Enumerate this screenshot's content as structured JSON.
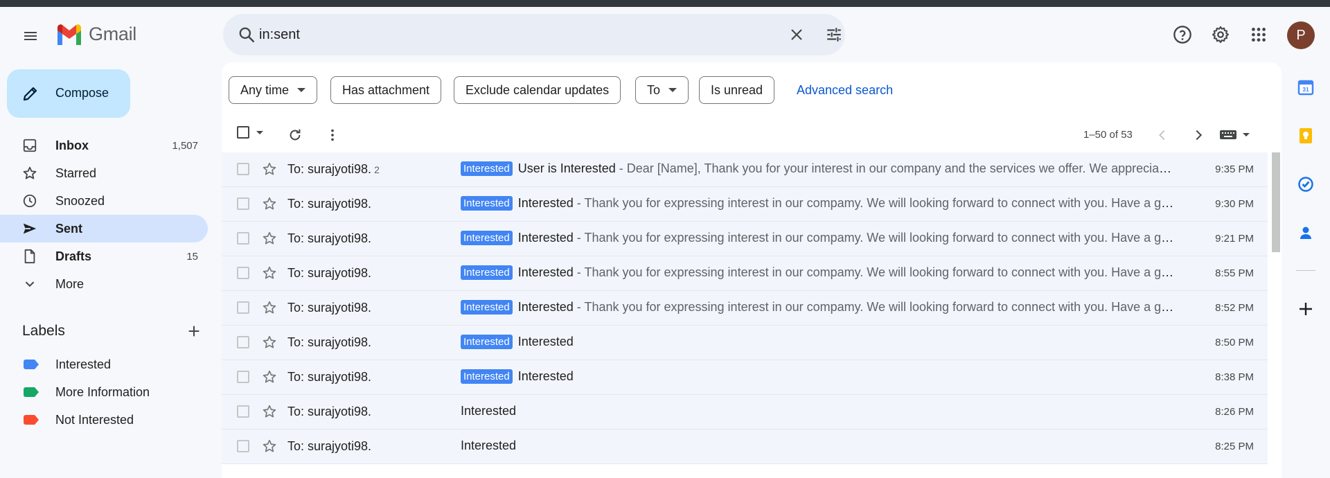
{
  "app": {
    "name": "Gmail"
  },
  "search": {
    "query": "in:sent"
  },
  "user": {
    "initial": "P"
  },
  "compose": {
    "label": "Compose"
  },
  "nav": [
    {
      "name": "inbox",
      "label": "Inbox",
      "count": "1,507",
      "icon": "inbox-icon",
      "bold": true
    },
    {
      "name": "starred",
      "label": "Starred",
      "count": "",
      "icon": "star-icon",
      "bold": false
    },
    {
      "name": "snoozed",
      "label": "Snoozed",
      "count": "",
      "icon": "clock-icon",
      "bold": false
    },
    {
      "name": "sent",
      "label": "Sent",
      "count": "",
      "icon": "send-icon",
      "bold": true,
      "active": true
    },
    {
      "name": "drafts",
      "label": "Drafts",
      "count": "15",
      "icon": "draft-icon",
      "bold": true
    },
    {
      "name": "more",
      "label": "More",
      "count": "",
      "icon": "chevron-down-icon",
      "bold": false
    }
  ],
  "labels": {
    "title": "Labels",
    "items": [
      {
        "label": "Interested",
        "color": "#4285f4"
      },
      {
        "label": "More Information",
        "color": "#16a765"
      },
      {
        "label": "Not Interested",
        "color": "#fb4c2f"
      }
    ]
  },
  "chips": {
    "any_time": "Any time",
    "has_attachment": "Has attachment",
    "exclude_calendar": "Exclude calendar updates",
    "to": "To",
    "is_unread": "Is unread",
    "advanced": "Advanced search"
  },
  "pager": {
    "text": "1–50 of 53"
  },
  "emails": [
    {
      "to": "To: surajyoti98.",
      "count": "2",
      "badge": "Interested",
      "subject": "User is Interested",
      "snippet": " - Dear [Name], Thank you for your interest in our company and the services we offer. We appreciate your interest and look forward to",
      "time": "9:35 PM"
    },
    {
      "to": "To: surajyoti98.",
      "count": "",
      "badge": "Interested",
      "subject": "Interested",
      "snippet": " - Thank you for expressing interest in our compamy. We will looking forward to connect with you. Have a great day",
      "time": "9:30 PM"
    },
    {
      "to": "To: surajyoti98.",
      "count": "",
      "badge": "Interested",
      "subject": "Interested",
      "snippet": " - Thank you for expressing interest in our compamy. We will looking forward to connect with you. Have a great day",
      "time": "9:21 PM"
    },
    {
      "to": "To: surajyoti98.",
      "count": "",
      "badge": "Interested",
      "subject": "Interested",
      "snippet": " - Thank you for expressing interest in our compamy. We will looking forward to connect with you. Have a great day",
      "time": "8:55 PM"
    },
    {
      "to": "To: surajyoti98.",
      "count": "",
      "badge": "Interested",
      "subject": "Interested",
      "snippet": " - Thank you for expressing interest in our compamy. We will looking forward to connect with you. Have a great day",
      "time": "8:52 PM"
    },
    {
      "to": "To: surajyoti98.",
      "count": "",
      "badge": "Interested",
      "subject": "Interested",
      "snippet": "",
      "time": "8:50 PM"
    },
    {
      "to": "To: surajyoti98.",
      "count": "",
      "badge": "Interested",
      "subject": "Interested",
      "snippet": "",
      "time": "8:38 PM"
    },
    {
      "to": "To: surajyoti98.",
      "count": "",
      "badge": "",
      "subject": "Interested",
      "snippet": "",
      "time": "8:26 PM"
    },
    {
      "to": "To: surajyoti98.",
      "count": "",
      "badge": "",
      "subject": "Interested",
      "snippet": "",
      "time": "8:25 PM"
    }
  ],
  "colors": {
    "accent": "#0b57d0",
    "compose_bg": "#c2e7ff",
    "active_nav": "#d3e3fd",
    "badge": "#4285f4"
  }
}
